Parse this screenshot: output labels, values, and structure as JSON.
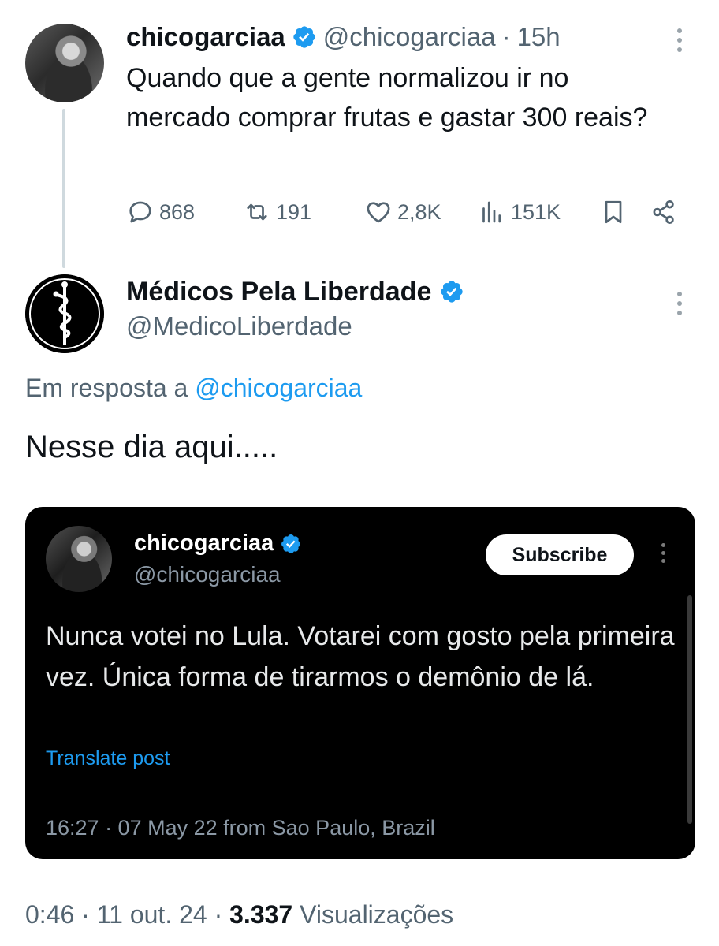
{
  "colors": {
    "accent": "#1d9bf0",
    "text_primary": "#0f1419",
    "text_secondary": "#536471",
    "embed_background": "#000000"
  },
  "parent_tweet": {
    "avatar_icon": "profile-photo",
    "display_name": "chicogarciaa",
    "verified_icon": "verified-badge-icon",
    "handle": "@chicogarciaa",
    "separator": "·",
    "time": "15h",
    "text": "Quando que a gente normalizou ir no mercado comprar frutas e gastar 300 reais?",
    "actions": {
      "replies": "868",
      "reposts": "191",
      "likes": "2,8K",
      "views": "151K"
    }
  },
  "reply_tweet": {
    "avatar_icon": "caduceus-logo",
    "display_name": "Médicos Pela Liberdade",
    "verified_icon": "verified-badge-icon",
    "handle": "@MedicoLiberdade",
    "reply_prefix": "Em resposta a",
    "reply_to": "@chicogarciaa",
    "text": "Nesse dia aqui.....",
    "embedded_screenshot": {
      "display_name": "chicogarciaa",
      "handle": "@chicogarciaa",
      "subscribe_label": "Subscribe",
      "text": "Nunca votei no Lula. Votarei com gosto pela primeira vez. Única forma de tirarmos o demônio de lá.",
      "translate_label": "Translate post",
      "meta": "16:27 · 07 May 22 from Sao Paulo, Brazil"
    },
    "footer": {
      "time": "0:46",
      "separator": "·",
      "date": "11 out. 24",
      "views_count": "3.337",
      "views_label": "Visualizações"
    }
  }
}
